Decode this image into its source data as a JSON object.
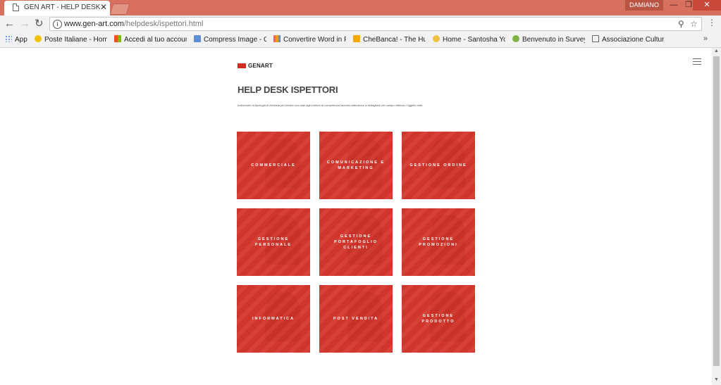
{
  "browser": {
    "tab_title": "GEN ART - HELP DESK",
    "tab_close": "✕",
    "user": "DAMIANO",
    "url_host": "www.gen-art.com",
    "url_path": "/helpdesk/ispettori.html",
    "bookmarks": [
      {
        "label": "App",
        "color": "#4a7bd6"
      },
      {
        "label": "Poste Italiane - Home",
        "color": "#f2c300"
      },
      {
        "label": "Accedi al tuo account",
        "color": "#e04a2f"
      },
      {
        "label": "Compress Image - Co",
        "color": "#5b8fd6"
      },
      {
        "label": "Convertire Word in PD",
        "color": "#e94b8a"
      },
      {
        "label": "CheBanca! - The Hum",
        "color": "#f5a800"
      },
      {
        "label": "Home - Santosha Yog",
        "color": "#f0c040"
      },
      {
        "label": "Benvenuto in SurveyM",
        "color": "#7cb342"
      },
      {
        "label": "Associazione Cultural",
        "color": "#ffffff"
      }
    ],
    "more": "»"
  },
  "site": {
    "logo_text": "GENART",
    "title": "HELP DESK ISPETTORI",
    "description": "Individuare la tipologia di richiesta per inviare una mail agli indirizzi di competenza facendo attenzione a dettagliare nel campo indirizzo Oggetto mail.",
    "tiles": [
      {
        "label": "COMMERCIALE"
      },
      {
        "label": "COMUNICAZIONE E MARKETING"
      },
      {
        "label": "GESTIONE ORDINE"
      },
      {
        "label": "GESTIONE PERSONALE"
      },
      {
        "label": "GESTIONE PORTAFOGLIO CLIENTI"
      },
      {
        "label": "GESTIONE PROMOZIONI"
      },
      {
        "label": "INFORMATICA"
      },
      {
        "label": "POST VENDITA"
      },
      {
        "label": "GESTIONE PRODOTTO"
      }
    ]
  },
  "colors": {
    "titlebar": "#d8705f",
    "tile_red": "#d6372c"
  }
}
